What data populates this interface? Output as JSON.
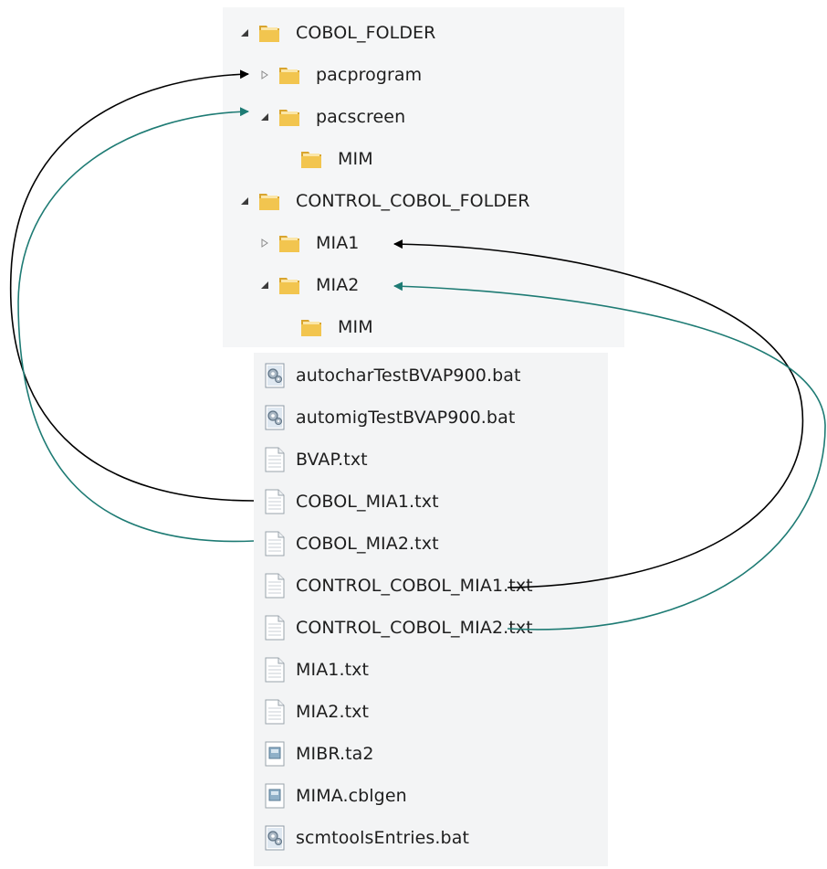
{
  "tree": {
    "items": [
      {
        "label": "COBOL_FOLDER",
        "state": "expanded"
      },
      {
        "label": "pacprogram",
        "state": "collapsed"
      },
      {
        "label": "pacscreen",
        "state": "expanded"
      },
      {
        "label": "MIM",
        "state": "leaf"
      },
      {
        "label": "CONTROL_COBOL_FOLDER",
        "state": "expanded"
      },
      {
        "label": "MIA1",
        "state": "collapsed"
      },
      {
        "label": "MIA2",
        "state": "expanded"
      },
      {
        "label": "MIM",
        "state": "leaf"
      }
    ]
  },
  "files": {
    "items": [
      {
        "label": "autocharTestBVAP900.bat",
        "icon": "batch-file-icon"
      },
      {
        "label": "automigTestBVAP900.bat",
        "icon": "batch-file-icon"
      },
      {
        "label": "BVAP.txt",
        "icon": "text-file-icon"
      },
      {
        "label": "COBOL_MIA1.txt",
        "icon": "text-file-icon"
      },
      {
        "label": "COBOL_MIA2.txt",
        "icon": "text-file-icon"
      },
      {
        "label": "CONTROL_COBOL_MIA1.txt",
        "icon": "text-file-icon"
      },
      {
        "label": "CONTROL_COBOL_MIA2.txt",
        "icon": "text-file-icon"
      },
      {
        "label": "MIA1.txt",
        "icon": "text-file-icon"
      },
      {
        "label": "MIA2.txt",
        "icon": "text-file-icon"
      },
      {
        "label": "MIBR.ta2",
        "icon": "generic-file-icon"
      },
      {
        "label": "MIMA.cblgen",
        "icon": "generic-file-icon"
      },
      {
        "label": "scmtoolsEntries.bat",
        "icon": "batch-file-icon"
      }
    ]
  },
  "colors": {
    "arrow_black": "#000000",
    "arrow_teal": "#1e7b74",
    "folder_yellow": "#f2c54f"
  }
}
